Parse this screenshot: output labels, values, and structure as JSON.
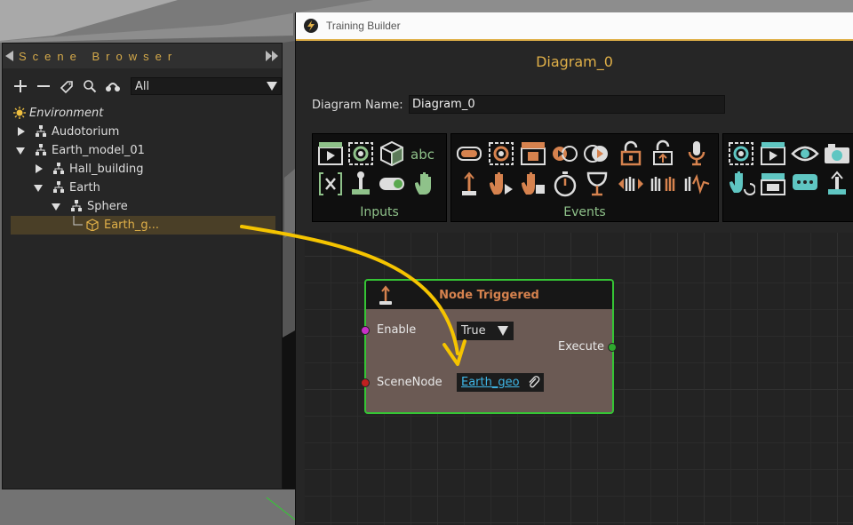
{
  "scene_browser": {
    "title": "Scene Browser",
    "filter_value": "All",
    "toolbar_icons": [
      "plus-icon",
      "minus-icon",
      "tag-icon",
      "search-icon",
      "link-icon"
    ],
    "tree": [
      {
        "label": "Environment",
        "depth": 0,
        "icon": "sun-icon",
        "twist": "none"
      },
      {
        "label": "Audotorium",
        "depth": 1,
        "icon": "hierarchy-icon",
        "twist": "right"
      },
      {
        "label": "Earth_model_01",
        "depth": 1,
        "icon": "hierarchy-icon",
        "twist": "down"
      },
      {
        "label": "Hall_building",
        "depth": 2,
        "icon": "hierarchy-icon",
        "twist": "right"
      },
      {
        "label": "Earth",
        "depth": 2,
        "icon": "hierarchy-icon",
        "twist": "down"
      },
      {
        "label": "Sphere",
        "depth": 3,
        "icon": "hierarchy-icon",
        "twist": "down"
      },
      {
        "label": "Earth_g...",
        "depth": 4,
        "icon": "cube-icon",
        "twist": "none",
        "selected": true
      }
    ]
  },
  "training_builder": {
    "window_title": "Training Builder",
    "diagram_title": "Diagram_0",
    "diagram_name_label": "Diagram Name:",
    "diagram_name_value": "Diagram_0",
    "palettes": [
      {
        "label": "Inputs"
      },
      {
        "label": "Events"
      }
    ],
    "node": {
      "title": "Node Triggered",
      "enable_label": "Enable",
      "enable_value": "True",
      "execute_label": "Execute",
      "scenenode_label": "SceneNode",
      "scenenode_value": "Earth_geo"
    }
  },
  "colors": {
    "accent": "#e0b048",
    "node_border": "#35c435",
    "node_title": "#d6824e",
    "palette_label": "#8fc28a",
    "link": "#3fb7e8",
    "arrow": "#f5c400"
  }
}
